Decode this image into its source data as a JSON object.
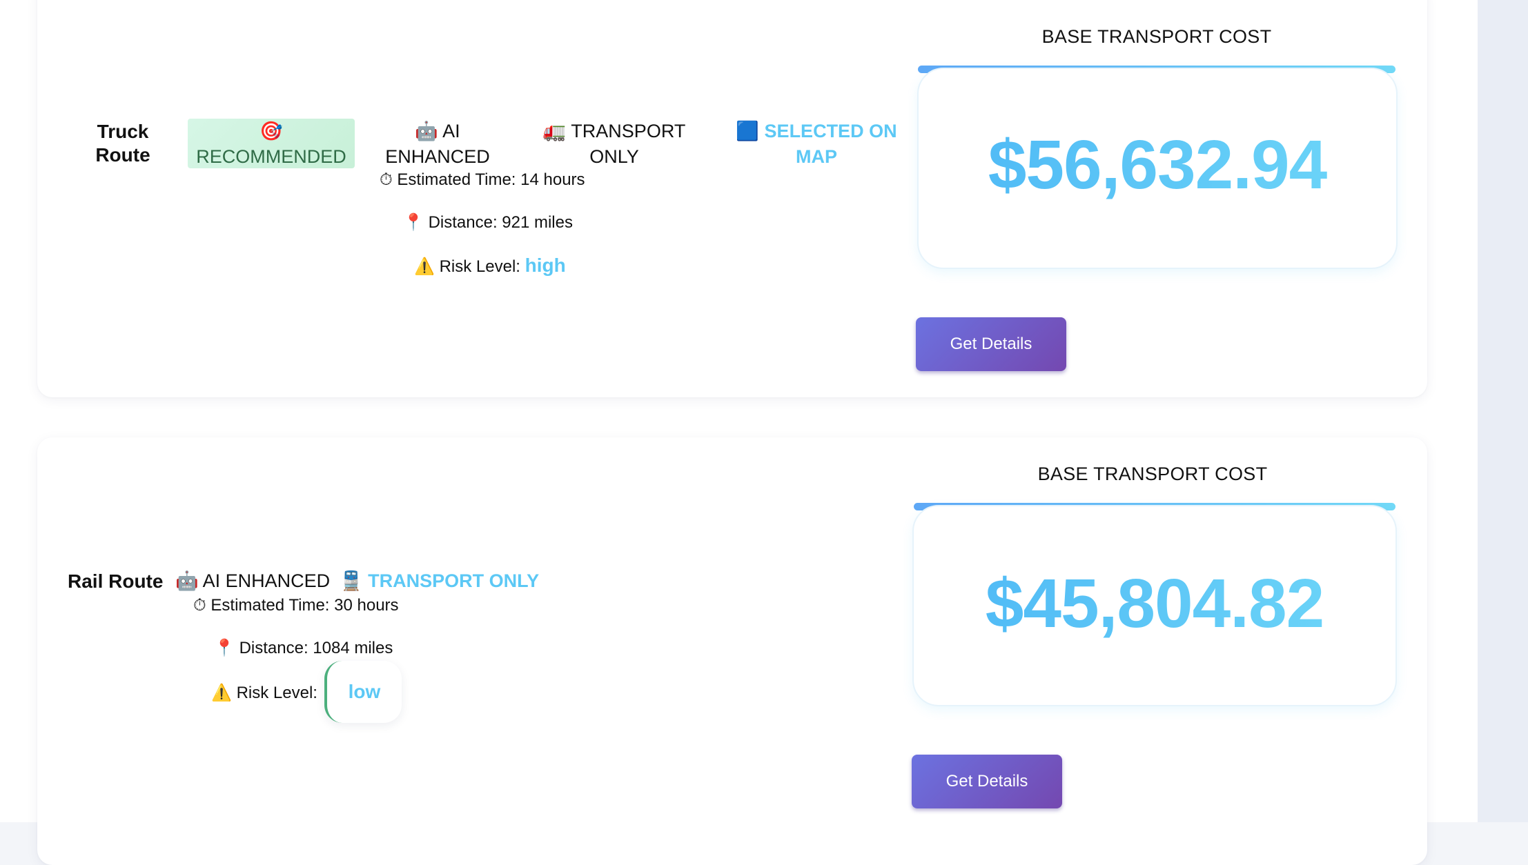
{
  "routes": [
    {
      "name": "Truck Route",
      "badges": [
        {
          "icon": "🎯",
          "label": "RECOMMENDED"
        },
        {
          "icon": "🤖",
          "label": "AI ENHANCED"
        },
        {
          "icon": "🚛",
          "label": "TRANSPORT ONLY"
        },
        {
          "icon": "🟦",
          "label": "SELECTED ON MAP"
        }
      ],
      "estimated_time": {
        "icon": "⏱",
        "text": "Estimated Time: 14 hours"
      },
      "distance": {
        "icon": "📍",
        "text": "Distance: 921 miles"
      },
      "risk": {
        "icon": "⚠️",
        "label": "Risk Level:",
        "value": "high"
      },
      "cost_label": "BASE TRANSPORT COST",
      "cost": "$56,632.94",
      "button_label": "Get Details"
    },
    {
      "name": "Rail Route",
      "badges": [
        {
          "icon": "🤖",
          "label": "AI ENHANCED"
        },
        {
          "icon": "🚆",
          "label": "TRANSPORT ONLY"
        }
      ],
      "estimated_time": {
        "icon": "⏱",
        "text": "Estimated Time: 30 hours"
      },
      "distance": {
        "icon": "📍",
        "text": "Distance: 1084 miles"
      },
      "risk": {
        "icon": "⚠️",
        "label": "Risk Level:",
        "value": "low"
      },
      "cost_label": "BASE TRANSPORT COST",
      "cost": "$45,804.82",
      "button_label": "Get Details"
    }
  ],
  "colors": {
    "accent_blue": "#5cc8f5",
    "recommended_bg": "#d6f6e6",
    "button_start": "#6c72e0",
    "button_end": "#7448b0",
    "risk_low_border": "#4caf7d"
  }
}
